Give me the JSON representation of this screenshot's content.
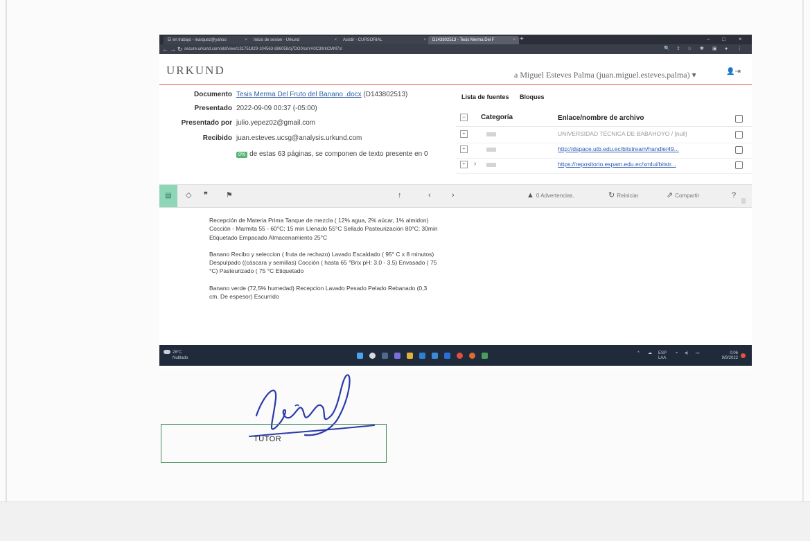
{
  "browser": {
    "tabs": [
      {
        "label": "El en trabajo - marquez@yahoo"
      },
      {
        "label": "Inicio de sesion - Urkund"
      },
      {
        "label": "Asistir - CURSORIAL"
      },
      {
        "label": "D143802513 - Tesis Merma Del F"
      }
    ],
    "url": "secure.urkund.com/old/view/131751829-104563-886058/q7DO0/ceYA0C39rkCMM7sl"
  },
  "urkund": {
    "logo": "URKUND",
    "user": "a Miguel Esteves Palma (juan.miguel.esteves.palma)",
    "meta": {
      "documento_label": "Documento",
      "documento_value": "Tesis Merma Del Fruto del Banano .docx",
      "documento_id": "(D143802513)",
      "presentado_label": "Presentado",
      "presentado_value": "2022-09-09 00:37 (-05:00)",
      "presentado_por_label": "Presentado por",
      "presentado_por_value": "julio.yepez02@gmail.com",
      "recibido_label": "Recibido",
      "recibido_value": "juan.esteves.ucsg@analysis.urkund.com",
      "pct": "0%",
      "summary": "de estas 63 páginas, se componen de texto presente en 0"
    },
    "sources": {
      "tab_list": "Lista de fuentes",
      "tab_blocks": "Bloques",
      "col_category": "Categoría",
      "col_link": "Enlace/nombre de archivo",
      "rows": [
        {
          "text": "UNIVERSIDAD TÉCNICA DE BABAHOYO / [null]"
        },
        {
          "text": "http://dspace.utb.edu.ec/bitstream/handle/49..."
        },
        {
          "text": "https://repositorio.espam.edu.ec/xmlui/bitstr..."
        }
      ]
    },
    "toolbar": {
      "warnings": "0 Advertencias.",
      "restart": "Reiniciar",
      "share": "Compartir"
    },
    "document_text": {
      "p1": "Recepción de Materia Prima Tanque de mezcla ( 12% agua, 2% aúcar, 1% almidon) Cocción - Marmita 55 - 60°C; 15 min Llenado 55°C Sellado Pasteurización 80°C; 30min Etiquetado Empacado Almacenamiento 25°C",
      "p2": "Banano Recibo y seleccion ( fruta de rechazo) Lavado Escaldado ( 95° C x 8 minutos) Despulpado ((cáscara y semillas) Cocción ( hasta 65 °Brix pH: 3.0 - 3.5) Envasado ( 75 °C) Pasteurizado ( 75 °C Etiquetado",
      "p3": "Banano verde (72,5% humedad) Recepcion Lavado Pesado Pelado Rebanado (0,3 cm. De espesor) Escurrido"
    }
  },
  "taskbar": {
    "weather_temp": "28°C",
    "weather_desc": "Nublado",
    "lang": "ESP",
    "lang_region": "LAA",
    "time": "0:06",
    "date": "9/9/2022"
  },
  "paper": {
    "tutor_label": "TUTOR"
  },
  "colors": {
    "urkund_green": "#54b574",
    "link_blue": "#2a5ab3",
    "taskbar": "#1f2a3a",
    "tutor_box_border": "#3f8a5b"
  }
}
